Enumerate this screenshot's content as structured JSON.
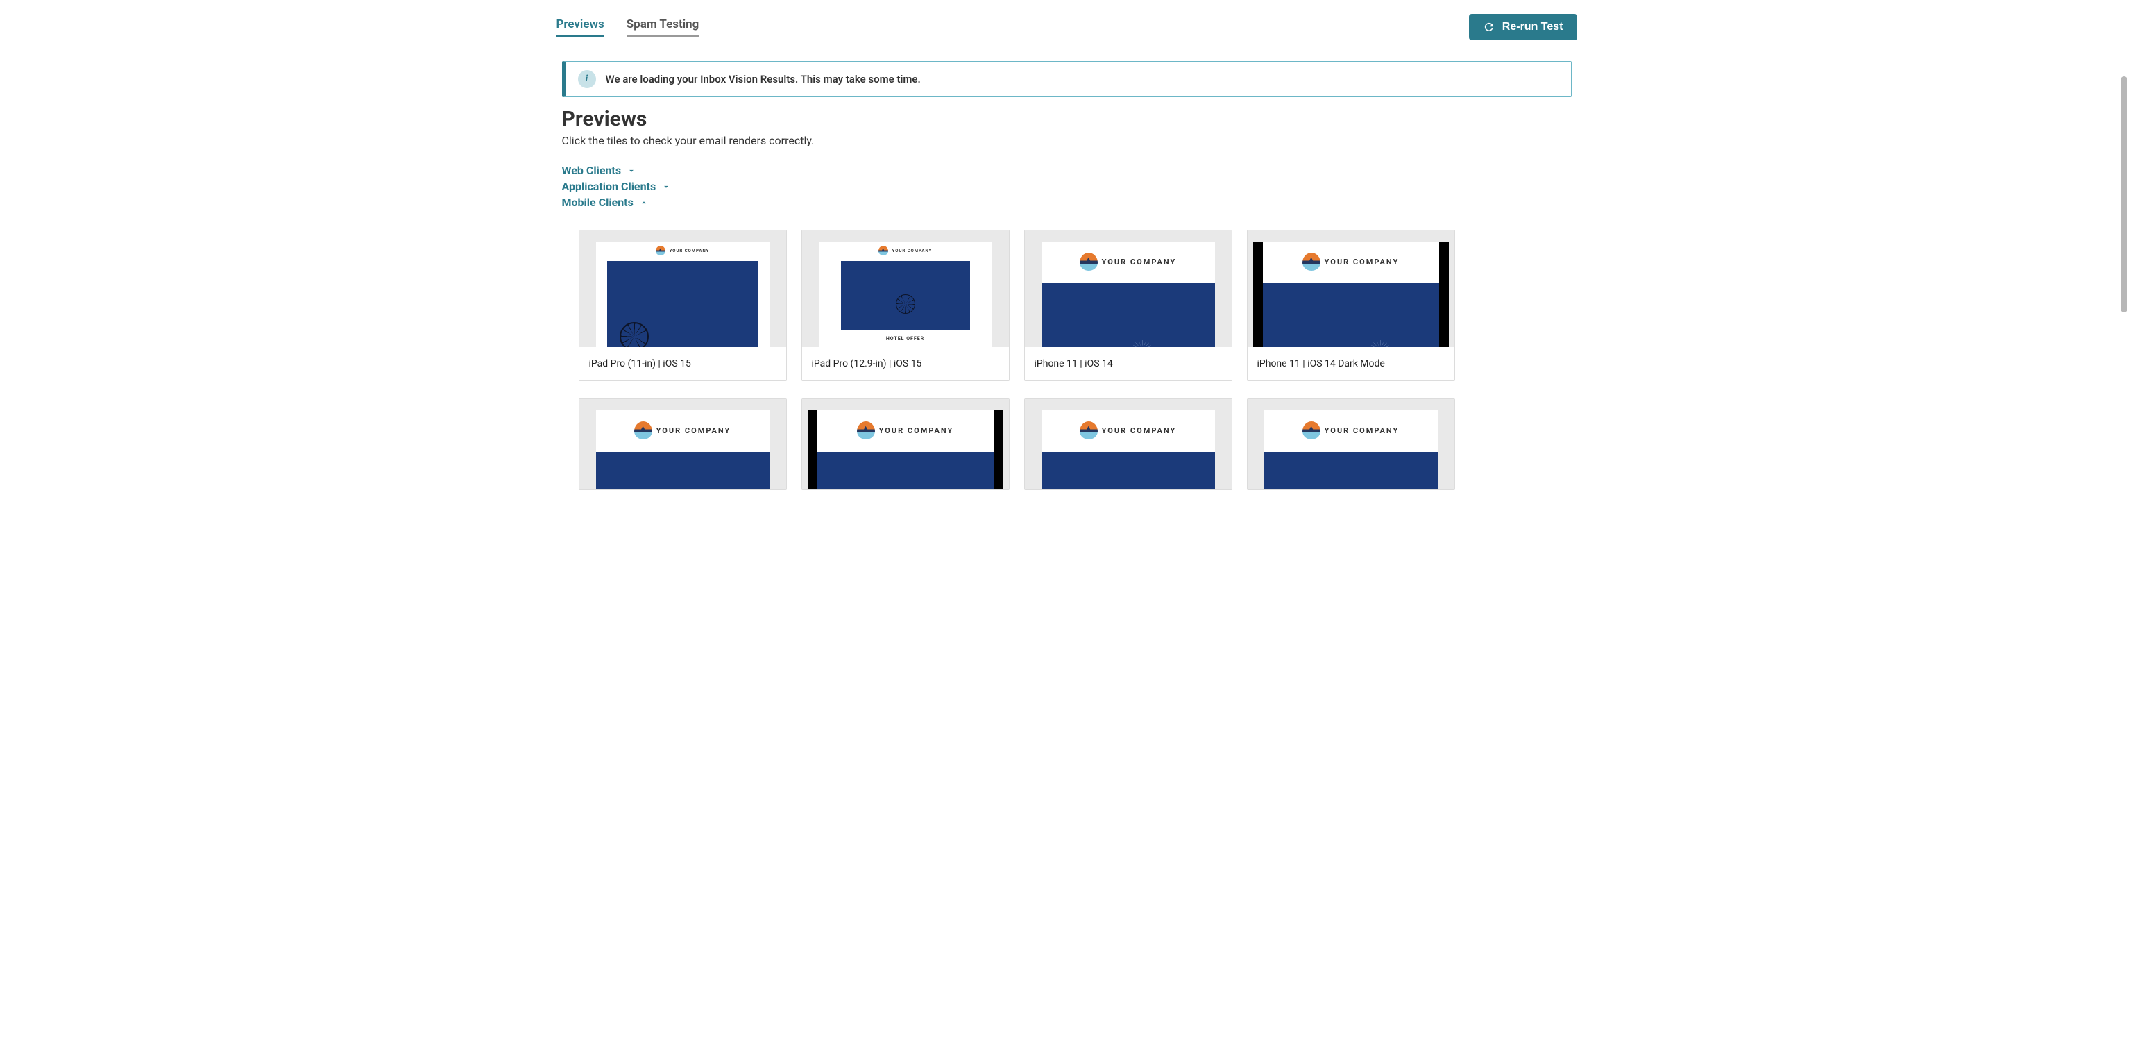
{
  "tabs": {
    "previews": "Previews",
    "spam": "Spam Testing"
  },
  "rerun_label": "Re-run Test",
  "banner": {
    "text": "We are loading your Inbox Vision Results. This may take some time."
  },
  "section": {
    "title": "Previews",
    "subtitle": "Click the tiles to check your email renders correctly."
  },
  "categories": {
    "web": "Web Clients",
    "app": "Application Clients",
    "mobile": "Mobile Clients"
  },
  "thumb": {
    "company": "YOUR COMPANY",
    "caption": "HOTEL OFFER"
  },
  "tiles_row1": [
    {
      "label": "iPad Pro (11-in) | iOS 15"
    },
    {
      "label": "iPad Pro (12.9-in) | iOS 15"
    },
    {
      "label": "iPhone 11 | iOS 14"
    },
    {
      "label": "iPhone 11 | iOS 14 Dark Mode"
    }
  ]
}
